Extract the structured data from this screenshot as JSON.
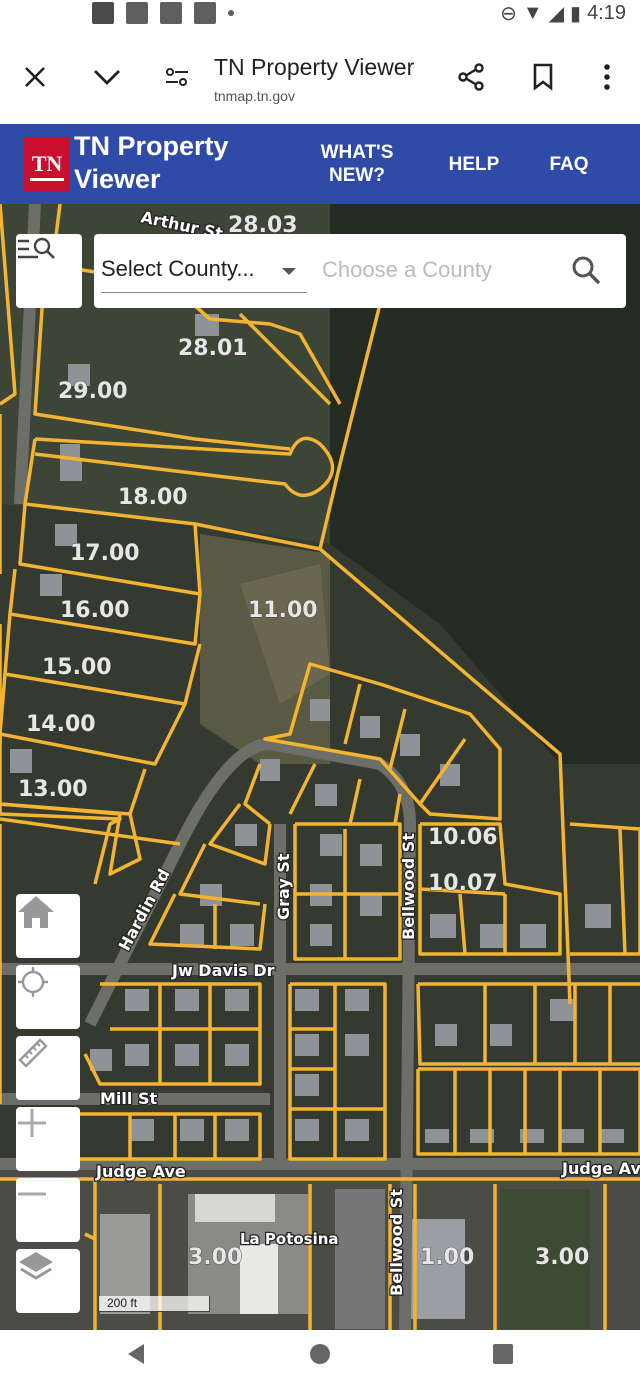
{
  "status_bar": {
    "time": "4:19"
  },
  "browser": {
    "page_title": "TN Property Viewer",
    "url": "tnmap.tn.gov"
  },
  "app_header": {
    "logo_text": "TN",
    "title": "TN Property Viewer",
    "nav": {
      "whats_new": "WHAT'S NEW?",
      "help": "HELP",
      "faq": "FAQ"
    }
  },
  "search": {
    "county_select": "Select County...",
    "placeholder": "Choose a County"
  },
  "map": {
    "parcel_labels": [
      "28.03",
      "28.01",
      "29.00",
      "18.00",
      "17.00",
      "16.00",
      "15.00",
      "14.00",
      "13.00",
      "11.00",
      "10.06",
      "10.07",
      "3.00",
      "1.00",
      "3.00"
    ],
    "streets": {
      "arthur": "Arthur St",
      "hardin": "Hardin Rd",
      "gray": "Gray St",
      "bellwood_n": "Bellwood St",
      "jw_davis": "Jw Davis Dr",
      "mill": "Mill St",
      "judge_w": "Judge Ave",
      "judge_e": "Judge Av",
      "bellwood_s": "Bellwood St"
    },
    "business": "La Potosina",
    "scale": "200 ft"
  },
  "colors": {
    "header_blue": "#2f4aa7",
    "logo_red": "#c8102e",
    "parcel_line": "#f3b431"
  }
}
